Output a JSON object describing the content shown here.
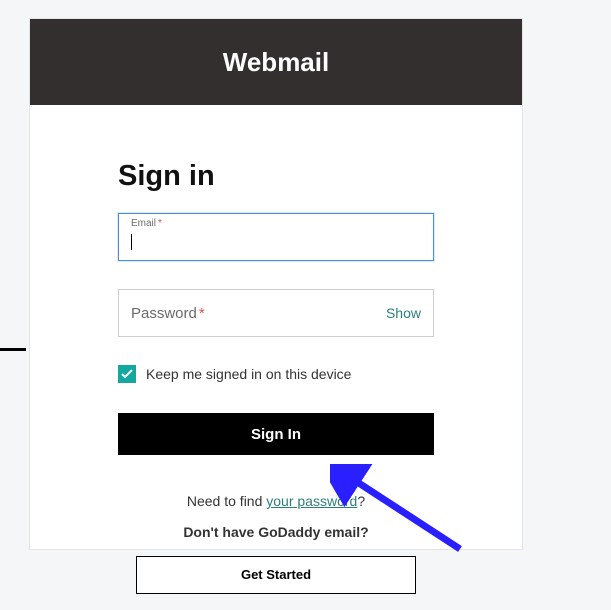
{
  "header": {
    "title": "Webmail"
  },
  "form": {
    "heading": "Sign in",
    "email": {
      "label": "Email",
      "required": "*",
      "value": ""
    },
    "password": {
      "label": "Password",
      "required": "*",
      "show": "Show",
      "value": ""
    },
    "remember": {
      "label": "Keep me signed in on this device",
      "checked": true
    },
    "submit": "Sign In",
    "find": {
      "prefix": "Need to find ",
      "link": "your password",
      "suffix": "?"
    }
  },
  "footer": {
    "no_email": "Don't have GoDaddy email?",
    "get_started": "Get Started"
  },
  "colors": {
    "accent": "#12a89d",
    "link": "#2b7f7a",
    "arrow": "#2a1fff"
  }
}
